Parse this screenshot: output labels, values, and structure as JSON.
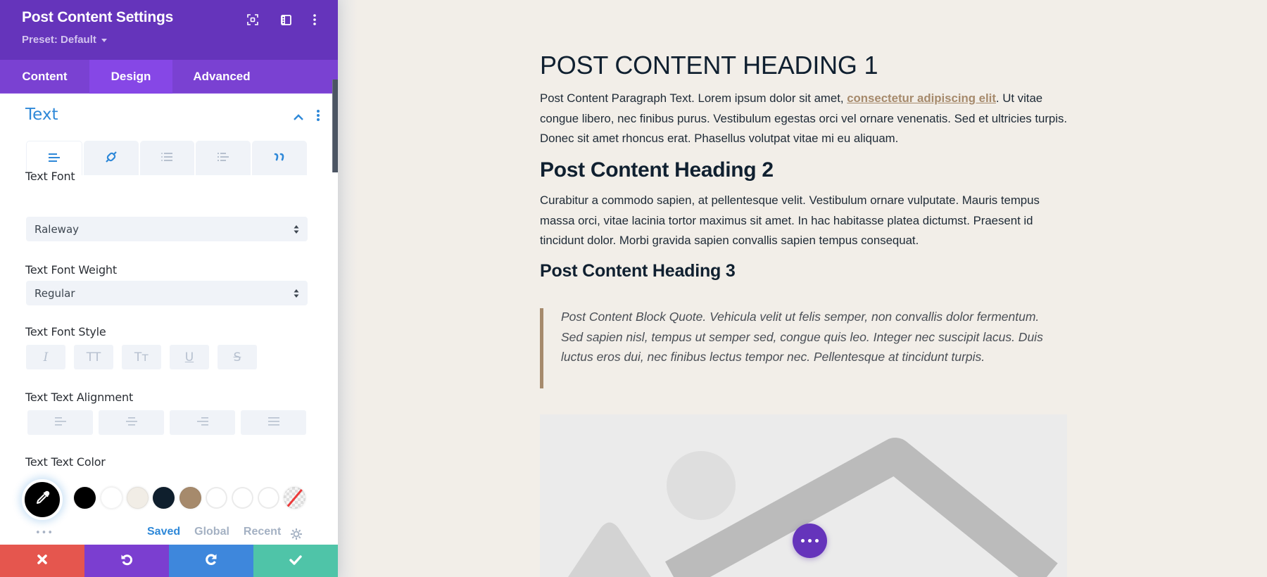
{
  "sidebar": {
    "title": "Post Content Settings",
    "preset": "Preset: Default",
    "header_icons": [
      "focus-mode-icon",
      "layout-toggle-icon",
      "more-options-icon"
    ],
    "tabs": [
      {
        "label": "Content",
        "active": false
      },
      {
        "label": "Design",
        "active": true
      },
      {
        "label": "Advanced",
        "active": false
      }
    ],
    "section": {
      "title": "Text",
      "expanded": true,
      "subtabs": [
        {
          "icon": "paragraph-align-icon",
          "active": true
        },
        {
          "icon": "link-icon",
          "active": false
        },
        {
          "icon": "unordered-list-icon",
          "active": false
        },
        {
          "icon": "ordered-list-icon",
          "active": false
        },
        {
          "icon": "quote-icon",
          "active": false
        }
      ]
    },
    "fields": {
      "font": {
        "label": "Text Font",
        "value": "Raleway"
      },
      "weight": {
        "label": "Text Font Weight",
        "value": "Regular"
      },
      "style": {
        "label": "Text Font Style",
        "buttons": [
          "I",
          "TT",
          "Tт",
          "U",
          "S"
        ]
      },
      "alignment": {
        "label": "Text Text Alignment",
        "buttons": [
          "left",
          "center",
          "right",
          "justify"
        ]
      },
      "color": {
        "label": "Text Text Color",
        "current": "#000000",
        "swatches": [
          "#000000",
          "#ffffff",
          "#f1ede6",
          "#0f1f2d",
          "#a68a6c",
          "#ffffff",
          "#ffffff",
          "#ffffff",
          "transparent"
        ],
        "more": "•••",
        "palette_tabs": [
          {
            "label": "Saved",
            "active": true
          },
          {
            "label": "Global",
            "active": false
          },
          {
            "label": "Recent",
            "active": false
          }
        ]
      }
    },
    "footer": {
      "cancel": {
        "icon": "close-icon",
        "color": "#e5564e"
      },
      "undo": {
        "icon": "undo-icon",
        "color": "#7b3ed0"
      },
      "redo": {
        "icon": "redo-icon",
        "color": "#3e87dc"
      },
      "save": {
        "icon": "check-icon",
        "color": "#4fc4a8"
      }
    }
  },
  "article": {
    "h1": "POST CONTENT HEADING 1",
    "p1_before": "Post Content Paragraph Text. Lorem ipsum dolor sit amet, ",
    "p1_link": "consectetur adipiscing elit",
    "p1_after": ". Ut vitae congue libero, nec finibus purus. Vestibulum egestas orci vel ornare venenatis. Sed et ultricies turpis. Donec sit amet rhoncus erat. Phasellus volutpat vitae mi eu aliquam.",
    "h2": "Post Content Heading 2",
    "p2": "Curabitur a commodo sapien, at pellentesque velit. Vestibulum ornare vulputate. Mauris tempus massa orci, vitae lacinia tortor maximus sit amet. In hac habitasse platea dictumst. Praesent id tincidunt dolor. Morbi gravida sapien convallis sapien tempus consequat.",
    "h3": "Post Content Heading 3",
    "quote": "Post Content Block Quote. Vehicula velit ut felis semper, non convallis dolor fermentum. Sed sapien nisl, tempus ut semper sed, congue quis leo. Integer nec suscipit lacus. Duis luctus eros dui, nec finibus lectus tempor nec. Pellentesque at tincidunt turpis.",
    "image_placeholder": "image-placeholder-icon"
  },
  "colors": {
    "header_purple": "#6534bb",
    "tab_purple": "#7a41d2",
    "accent_blue": "#2e88d8",
    "link_tan": "#a68a6c",
    "heading_navy": "#102030",
    "page_bg": "#f2eee8"
  }
}
